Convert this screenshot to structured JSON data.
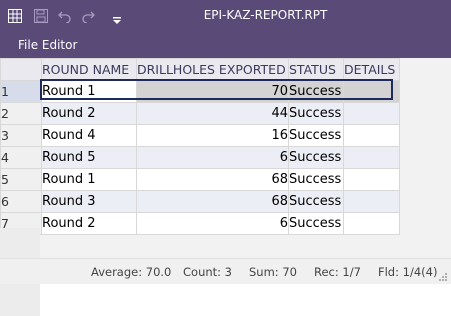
{
  "window": {
    "title": "EPI-KAZ-REPORT.RPT"
  },
  "toolbar": {
    "icons": [
      "grid-icon",
      "save-icon",
      "undo-icon",
      "redo-icon",
      "dropdown-caret-icon"
    ]
  },
  "menu": {
    "file_editor": "File Editor"
  },
  "table": {
    "columns": [
      "ROUND NAME",
      "DRILLHOLES EXPORTED",
      "STATUS",
      "DETAILS"
    ],
    "rows": [
      {
        "num": "1",
        "name": "Round 1",
        "exported": "70",
        "status": "Success",
        "details": ""
      },
      {
        "num": "2",
        "name": "Round 2",
        "exported": "44",
        "status": "Success",
        "details": ""
      },
      {
        "num": "3",
        "name": "Round 4",
        "exported": "16",
        "status": "Success",
        "details": ""
      },
      {
        "num": "4",
        "name": "Round 5",
        "exported": "6",
        "status": "Success",
        "details": ""
      },
      {
        "num": "5",
        "name": "Round 1",
        "exported": "68",
        "status": "Success",
        "details": ""
      },
      {
        "num": "6",
        "name": "Round 3",
        "exported": "68",
        "status": "Success",
        "details": ""
      },
      {
        "num": "7",
        "name": "Round 2",
        "exported": "6",
        "status": "Success",
        "details": ""
      }
    ],
    "selected_row": 1
  },
  "status": {
    "average": "Average: 70.0",
    "count": "Count: 3",
    "sum": "Sum: 70",
    "rec": "Rec: 1/7",
    "fld": "Fld: 1/4(4)"
  },
  "colors": {
    "titlebar": "#5a4a78",
    "selection_border": "#1e2a5a",
    "alt_row": "#eceef6"
  }
}
